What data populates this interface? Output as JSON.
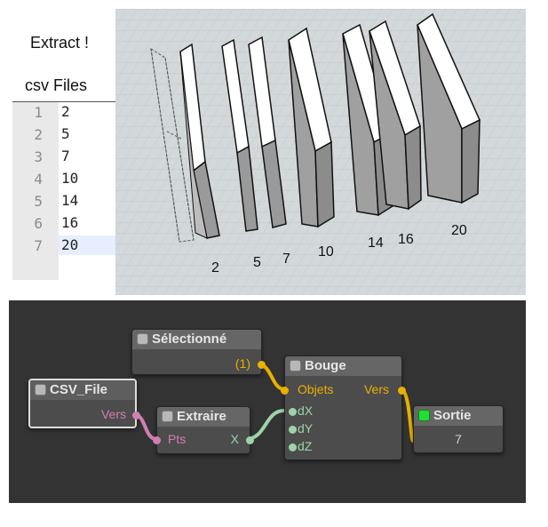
{
  "left_panel": {
    "extract_label": "Extract !",
    "csv_header": "csv Files",
    "rows": [
      {
        "line": "1",
        "value": "2"
      },
      {
        "line": "2",
        "value": "5"
      },
      {
        "line": "3",
        "value": "7"
      },
      {
        "line": "4",
        "value": "10"
      },
      {
        "line": "5",
        "value": "14"
      },
      {
        "line": "6",
        "value": "16"
      },
      {
        "line": "7",
        "value": "20"
      }
    ]
  },
  "viewport": {
    "slab_labels": [
      "2",
      "5",
      "7",
      "10",
      "14",
      "16",
      "20"
    ]
  },
  "node_editor": {
    "nodes": {
      "selectionne": {
        "title": "Sélectionné",
        "output": "(1)"
      },
      "csv_file": {
        "title": "CSV_File",
        "output": "Vers"
      },
      "extraire": {
        "title": "Extraire",
        "input": "Pts",
        "output": "X"
      },
      "bouge": {
        "title": "Bouge",
        "input_objets": "Objets",
        "input_dx": "dX",
        "input_dy": "dY",
        "input_dz": "dZ",
        "output": "Vers"
      },
      "sortie": {
        "title": "Sortie",
        "value": "7"
      }
    }
  },
  "colors": {
    "editor_background": "#333333",
    "node_body": "#4c4c4c",
    "wire_object": "#e8b000",
    "wire_points": "#d07fb4",
    "wire_number": "#9ed3a9",
    "enabled_toggle": "#22dd33",
    "viewport_background": "#d3d8da"
  }
}
